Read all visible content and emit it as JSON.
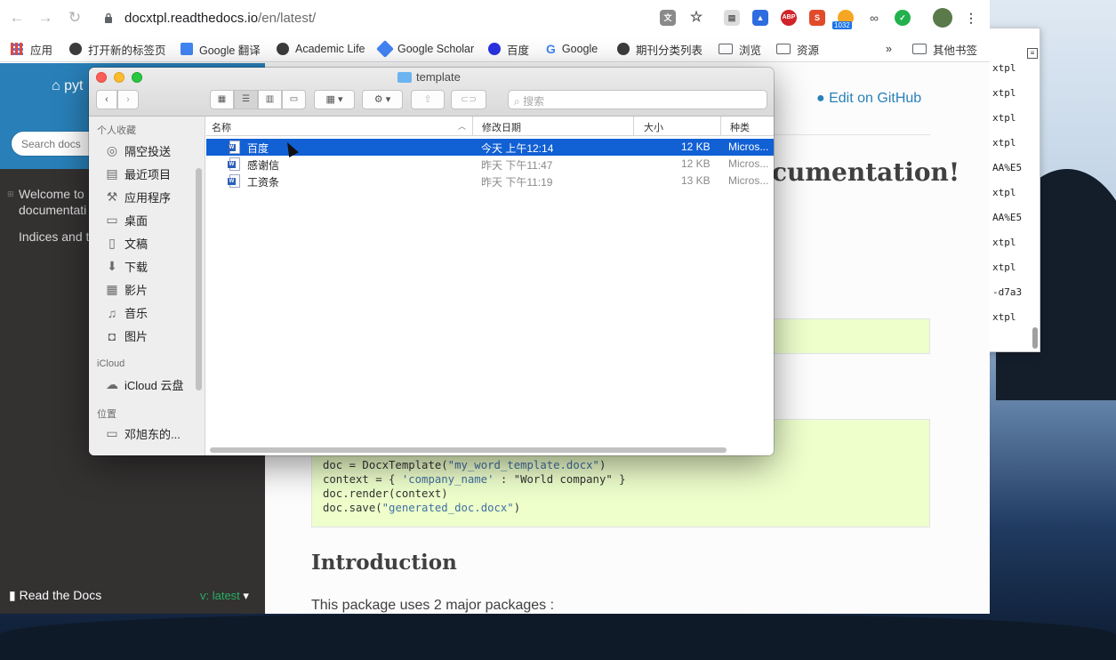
{
  "browser": {
    "url_domain": "docxtpl.readthedocs.io",
    "url_path": "/en/latest/",
    "ext_badge": "1032",
    "bookmarks": [
      {
        "label": "应用"
      },
      {
        "label": "打开新的标签页"
      },
      {
        "label": "Google 翻译"
      },
      {
        "label": "Academic Life"
      },
      {
        "label": "Google Scholar"
      },
      {
        "label": "百度"
      },
      {
        "label": "Google"
      },
      {
        "label": "期刊分类列表"
      },
      {
        "label": "浏览"
      },
      {
        "label": "资源"
      }
    ],
    "more": "»",
    "other_bookmarks": "其他书签"
  },
  "rtd": {
    "home": "pyt",
    "search_placeholder": "Search docs",
    "nav": [
      "Welcome to",
      "documentati",
      "Indices and t"
    ],
    "footer": "Read the Docs",
    "version": "v: latest",
    "edit_github": "Edit on GitHub",
    "heading": "cumentation!",
    "code_lines": [
      {
        "plain_a": "doc = DocxTemplate(",
        "str": "\"my_word_template.docx\"",
        "plain_b": ")"
      },
      {
        "plain_a": "context = { ",
        "str": "'company_name'",
        "plain_b": " : \"World company\" }"
      },
      {
        "plain_a": "doc.render(context)",
        "str": "",
        "plain_b": ""
      },
      {
        "plain_a": "doc.save(",
        "str": "\"generated_doc.docx\"",
        "plain_b": ")"
      }
    ],
    "intro_heading": "Introduction",
    "intro_text": "This package uses 2 major packages :"
  },
  "terminal": {
    "lines": [
      "xtpl",
      "xtpl",
      "xtpl",
      "xtpl",
      "AA%E5",
      "xtpl",
      "AA%E5",
      "xtpl",
      "xtpl",
      "-d7a3",
      "xtpl"
    ]
  },
  "finder": {
    "title": "template",
    "search_placeholder": "搜索",
    "sidebar": {
      "favorites_head": "个人收藏",
      "favorites": [
        "隔空投送",
        "最近项目",
        "应用程序",
        "桌面",
        "文稿",
        "下载",
        "影片",
        "音乐",
        "图片"
      ],
      "icloud_head": "iCloud",
      "icloud": [
        "iCloud 云盘"
      ],
      "location_head": "位置",
      "locations": [
        "邓旭东的..."
      ]
    },
    "columns": {
      "name": "名称",
      "date": "修改日期",
      "size": "大小",
      "kind": "种类"
    },
    "files": [
      {
        "name": "百度",
        "date": "今天 上午12:14",
        "size": "12 KB",
        "kind": "Micros...",
        "selected": true
      },
      {
        "name": "感谢信",
        "date": "昨天 下午11:47",
        "size": "12 KB",
        "kind": "Micros...",
        "selected": false
      },
      {
        "name": "工资条",
        "date": "昨天 下午11:19",
        "size": "13 KB",
        "kind": "Micros...",
        "selected": false
      }
    ]
  }
}
